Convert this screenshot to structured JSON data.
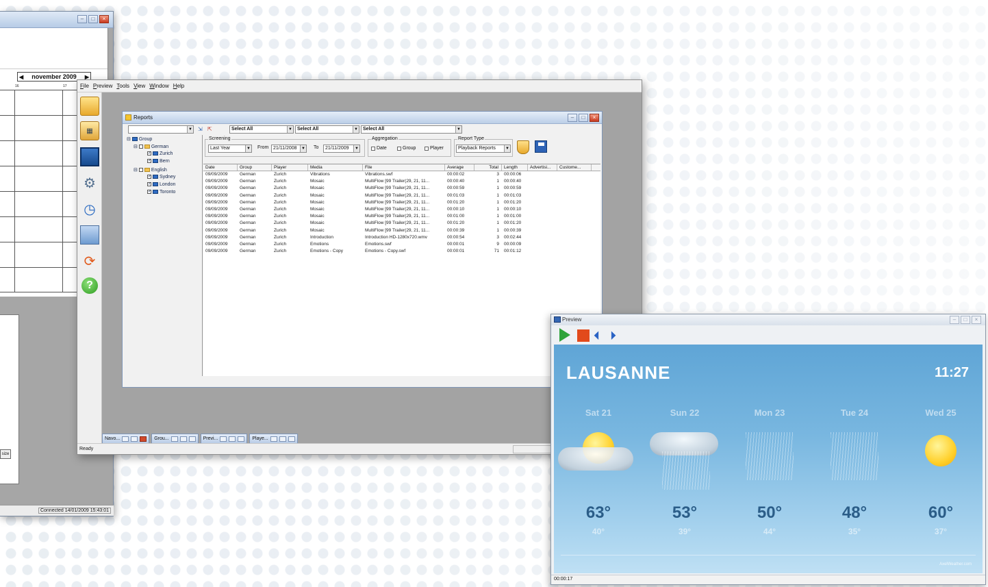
{
  "calendar_window": {
    "month_label": "november 2009",
    "day_cols": [
      "16",
      "17"
    ],
    "size_button": "size",
    "status": "Connected 14/01/2009 15:43:01"
  },
  "main_window": {
    "menu": [
      "File",
      "Preview",
      "Tools",
      "View",
      "Window",
      "Help"
    ],
    "status": "Ready",
    "taskbar": [
      "Navo...",
      "Grou...",
      "Previ...",
      "Playe..."
    ]
  },
  "reports": {
    "title": "Reports",
    "select_all_1": "Select All",
    "select_all_2": "Select All",
    "select_all_3": "Select All",
    "screening": {
      "legend": "Screening",
      "period": "Last Year",
      "from_label": "From",
      "from_value": "21/11/2008",
      "to_label": "To",
      "to_value": "21/11/2009"
    },
    "aggregation": {
      "legend": "Aggregation",
      "date": "Date",
      "group": "Group",
      "player": "Player"
    },
    "report_type": {
      "legend": "Report Type",
      "value": "Playback Reports"
    },
    "tree": {
      "root": "Group",
      "german": "German",
      "zurich": "Zurich",
      "bern": "Bern",
      "english": "English",
      "sydney": "Sydney",
      "london": "London",
      "toronto": "Toronto"
    },
    "columns": [
      "Date",
      "Group",
      "Player",
      "Media",
      "File",
      "Average",
      "Total",
      "Length",
      "Advertisi...",
      "Custome..."
    ],
    "rows": [
      [
        "09/09/2009",
        "German",
        "Zurich",
        "Vibrations",
        "Vibrations.swf",
        "00:00:02",
        "3",
        "00:00:06"
      ],
      [
        "09/09/2009",
        "German",
        "Zurich",
        "Mosaic",
        "MultiFlow [99 Trailer(29, 21, 11...",
        "00:00:40",
        "1",
        "00:00:40"
      ],
      [
        "09/09/2009",
        "German",
        "Zurich",
        "Mosaic",
        "MultiFlow [99 Trailer(29, 21, 11...",
        "00:00:59",
        "1",
        "00:00:59"
      ],
      [
        "09/09/2009",
        "German",
        "Zurich",
        "Mosaic",
        "MultiFlow [99 Trailer(29, 21, 11...",
        "00:01:03",
        "1",
        "00:01:03"
      ],
      [
        "09/09/2009",
        "German",
        "Zurich",
        "Mosaic",
        "MultiFlow [99 Trailer(29, 21, 11...",
        "00:01:20",
        "1",
        "00:01:20"
      ],
      [
        "09/09/2009",
        "German",
        "Zurich",
        "Mosaic",
        "MultiFlow [99 Trailer(29, 21, 11...",
        "00:00:10",
        "1",
        "00:00:10"
      ],
      [
        "09/09/2009",
        "German",
        "Zurich",
        "Mosaic",
        "MultiFlow [99 Trailer(29, 21, 11...",
        "00:01:00",
        "1",
        "00:01:00"
      ],
      [
        "09/09/2009",
        "German",
        "Zurich",
        "Mosaic",
        "MultiFlow [99 Trailer(29, 21, 11...",
        "00:01:20",
        "1",
        "00:01:20"
      ],
      [
        "09/09/2009",
        "German",
        "Zurich",
        "Mosaic",
        "MultiFlow [99 Trailer(29, 21, 11...",
        "00:00:39",
        "1",
        "00:00:39"
      ],
      [
        "09/09/2009",
        "German",
        "Zurich",
        "Introduction",
        "Introduction HD-1280x720.wmv",
        "00:00:54",
        "3",
        "00:02:44"
      ],
      [
        "09/09/2009",
        "German",
        "Zurich",
        "Emotions",
        "Emotions.swf",
        "00:00:01",
        "9",
        "00:00:09"
      ],
      [
        "09/09/2009",
        "German",
        "Zurich",
        "Emotions - Copy",
        "Emotions - Copy.swf",
        "00:00:01",
        "71",
        "00:01:12"
      ]
    ]
  },
  "preview": {
    "title": "Preview",
    "city": "LAUSANNE",
    "time": "11:27",
    "days": [
      {
        "name": "Sat 21",
        "hi": "63°",
        "lo": "40°",
        "icon": "partly-cloudy-icon"
      },
      {
        "name": "Sun 22",
        "hi": "53°",
        "lo": "39°",
        "icon": "rain-cloud-icon"
      },
      {
        "name": "Mon 23",
        "hi": "50°",
        "lo": "44°",
        "icon": "rain-icon"
      },
      {
        "name": "Tue 24",
        "hi": "48°",
        "lo": "35°",
        "icon": "rain-icon"
      },
      {
        "name": "Wed 25",
        "hi": "60°",
        "lo": "37°",
        "icon": "sun-icon"
      }
    ],
    "brand": "AxelWeather.com",
    "status": "00:00:17"
  }
}
